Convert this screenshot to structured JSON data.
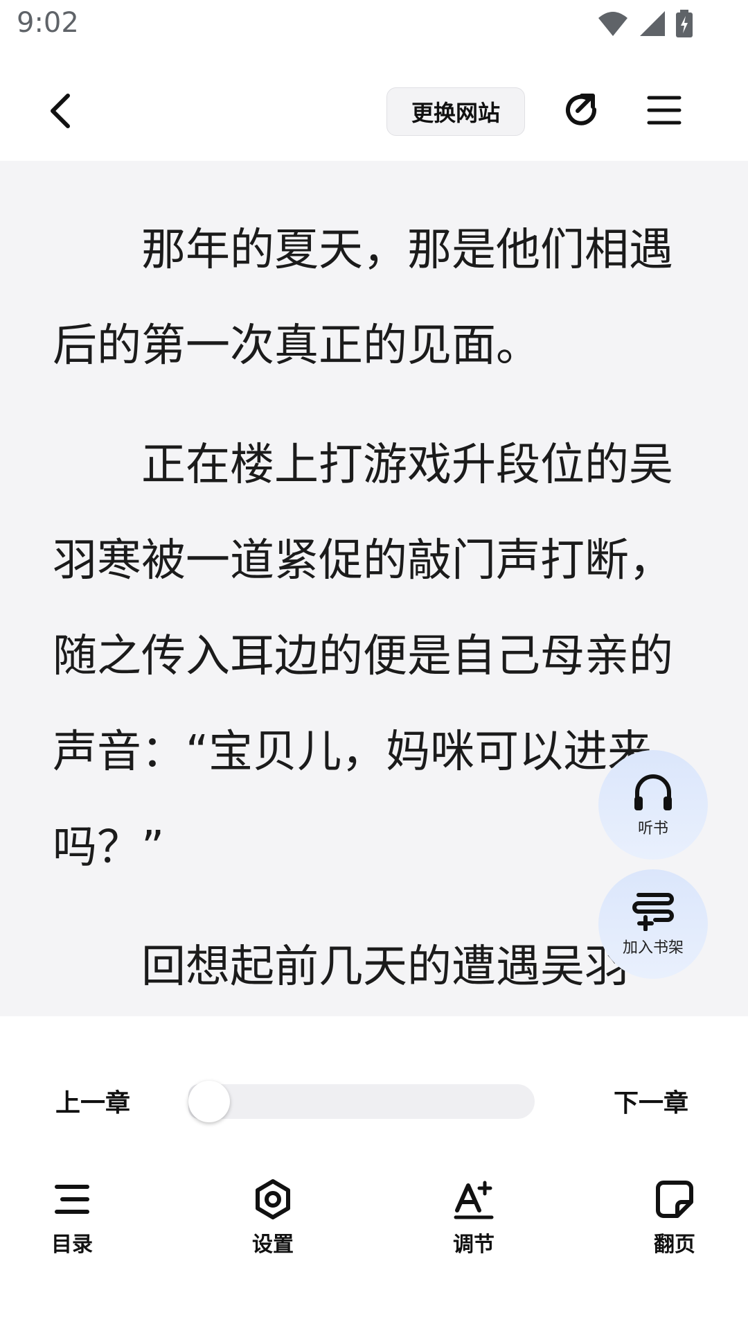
{
  "status": {
    "time": "9:02"
  },
  "topbar": {
    "switch_site_label": "更换网站"
  },
  "reader": {
    "paragraphs": [
      "那年的夏天，那是他们相遇后的第一次真正的见面。",
      "正在楼上打游戏升段位的吴羽寒被一道紧促的敲门声打断，随之传入耳边的便是自己母亲的声音：“宝贝儿，妈咪可以进来吗？”",
      "回想起前几天的遭遇吴羽"
    ]
  },
  "fab": {
    "listen_label": "听书",
    "shelf_label": "加入书架"
  },
  "chapter_nav": {
    "prev_label": "上一章",
    "next_label": "下一章",
    "progress": 0.0
  },
  "bottom_nav": {
    "items": [
      {
        "label": "目录",
        "icon": "list-icon"
      },
      {
        "label": "设置",
        "icon": "settings-icon"
      },
      {
        "label": "调节",
        "icon": "font-adjust-icon"
      },
      {
        "label": "翻页",
        "icon": "page-turn-icon"
      }
    ]
  }
}
